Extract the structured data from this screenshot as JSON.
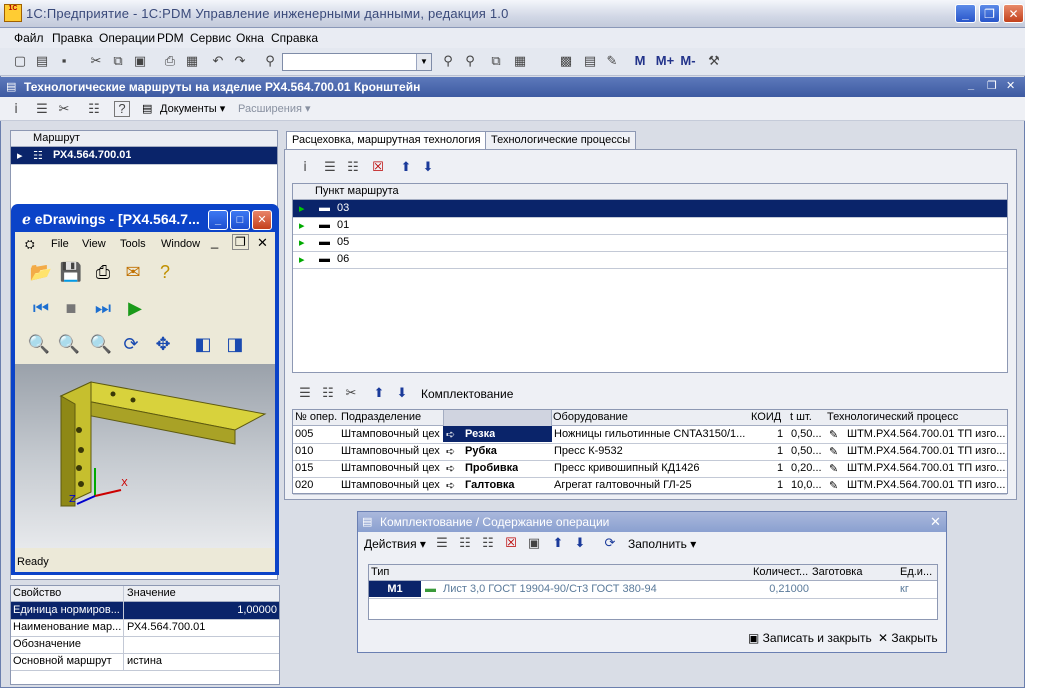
{
  "app": {
    "title": "1С:Предприятие - 1С:PDM Управление инженерными данными, редакция 1.0",
    "logo_text": "1C"
  },
  "menu": [
    "Файл",
    "Правка",
    "Операции",
    "PDM",
    "Сервис",
    "Окна",
    "Справка"
  ],
  "toolbar": {
    "m_buttons": [
      "M",
      "M+",
      "M-"
    ]
  },
  "doc": {
    "title": "Технологические маршруты на изделие РХ4.564.700.01 Кронштейн",
    "documents_label": "Документы",
    "extensions_label": "Расширения"
  },
  "route_tree": {
    "header": "Маршрут",
    "items": [
      {
        "label": "РХ4.564.700.01"
      }
    ]
  },
  "tabs": [
    {
      "label": "Расцеховка, маршрутная технология"
    },
    {
      "label": "Технологические процессы"
    }
  ],
  "points": {
    "header": "Пункт маршрута",
    "rows": [
      "03",
      "01",
      "05",
      "06"
    ]
  },
  "ops_toolbar": {
    "kit_label": "Комплектование"
  },
  "ops": {
    "headers": [
      "№ опер.",
      "Подразделение",
      "",
      "Оборудование",
      "КОИД",
      "t шт.",
      "Технологический процесс"
    ],
    "rows": [
      {
        "num": "005",
        "dept": "Штамповочный цех",
        "op": "Резка",
        "equip": "Ножницы гильотинные CNTA3150/1...",
        "koid": "1",
        "t": "0,50...",
        "tp": "ШТМ.РХ4.564.700.01 ТП изго..."
      },
      {
        "num": "010",
        "dept": "Штамповочный цех",
        "op": "Рубка",
        "equip": "Пресс К-9532",
        "koid": "1",
        "t": "0,50...",
        "tp": "ШТМ.РХ4.564.700.01 ТП изго..."
      },
      {
        "num": "015",
        "dept": "Штамповочный цех",
        "op": "Пробивка",
        "equip": "Пресс кривошипный КД1426",
        "koid": "1",
        "t": "0,20...",
        "tp": "ШТМ.РХ4.564.700.01 ТП изго..."
      },
      {
        "num": "020",
        "dept": "Штамповочный цех",
        "op": "Галтовка",
        "equip": "Агрегат галтовочный ГЛ-25",
        "koid": "1",
        "t": "10,0...",
        "tp": "ШТМ.РХ4.564.700.01 ТП изго..."
      }
    ]
  },
  "edrawings": {
    "title": "eDrawings - [PX4.564.7...",
    "menu": [
      "File",
      "View",
      "Tools",
      "Window"
    ],
    "status": "Ready"
  },
  "props": {
    "headers": [
      "Свойство",
      "Значение"
    ],
    "rows": [
      {
        "k": "Единица нормиров...",
        "v": "1,00000"
      },
      {
        "k": "Наименование мар...",
        "v": "РХ4.564.700.01"
      },
      {
        "k": "Обозначение",
        "v": ""
      },
      {
        "k": "Основной маршрут",
        "v": "истина"
      }
    ]
  },
  "dialog": {
    "title": "Комплектование / Содержание операции",
    "actions_label": "Действия",
    "fill_label": "Заполнить",
    "headers": [
      "Тип",
      "",
      "Количест...",
      "Заготовка",
      "Ед.и..."
    ],
    "row": {
      "type": "M1",
      "desc": "Лист 3,0 ГОСТ 19904-90/Ст3 ГОСТ 380-94",
      "qty": "0,21000",
      "blank": "",
      "unit": "кг"
    },
    "save_label": "Записать и закрыть",
    "close_label": "Закрыть"
  },
  "colors": {
    "selection": "#0a246a",
    "doc_bar": "#4a67ab",
    "window_bg": "#d9dde6"
  }
}
